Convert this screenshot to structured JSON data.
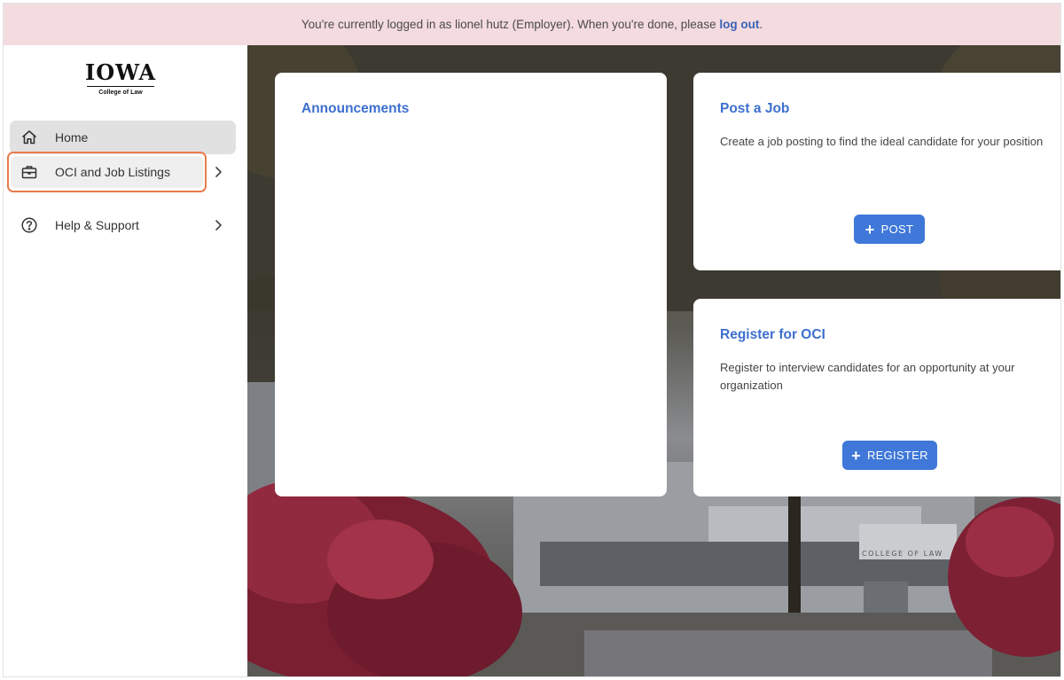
{
  "banner": {
    "text": "You're currently logged in as lionel hutz (Employer). When you're done, please ",
    "link": "log out",
    "suffix": "."
  },
  "logo": {
    "word": "IOWA",
    "sub": "College of Law"
  },
  "sidebar": {
    "items": [
      {
        "label": "Home",
        "icon": "home-icon"
      },
      {
        "label": "OCI and Job Listings",
        "icon": "briefcase-icon"
      },
      {
        "label": "Help & Support",
        "icon": "help-circle-icon"
      }
    ]
  },
  "hero": {
    "building_sign": "COLLEGE OF LAW"
  },
  "cards": {
    "announcements": {
      "title": "Announcements"
    },
    "post": {
      "title": "Post a Job",
      "description": "Create a job posting to find the ideal candidate for your position",
      "button": "POST"
    },
    "register": {
      "title": "Register for OCI",
      "description": "Register to interview candidates for an opportunity at your organization",
      "button": "REGISTER"
    }
  },
  "colors": {
    "accent": "#3d6fcf",
    "button": "#3f78d8",
    "banner_bg": "#f4dbe0",
    "highlight": "#ea7b4b"
  }
}
